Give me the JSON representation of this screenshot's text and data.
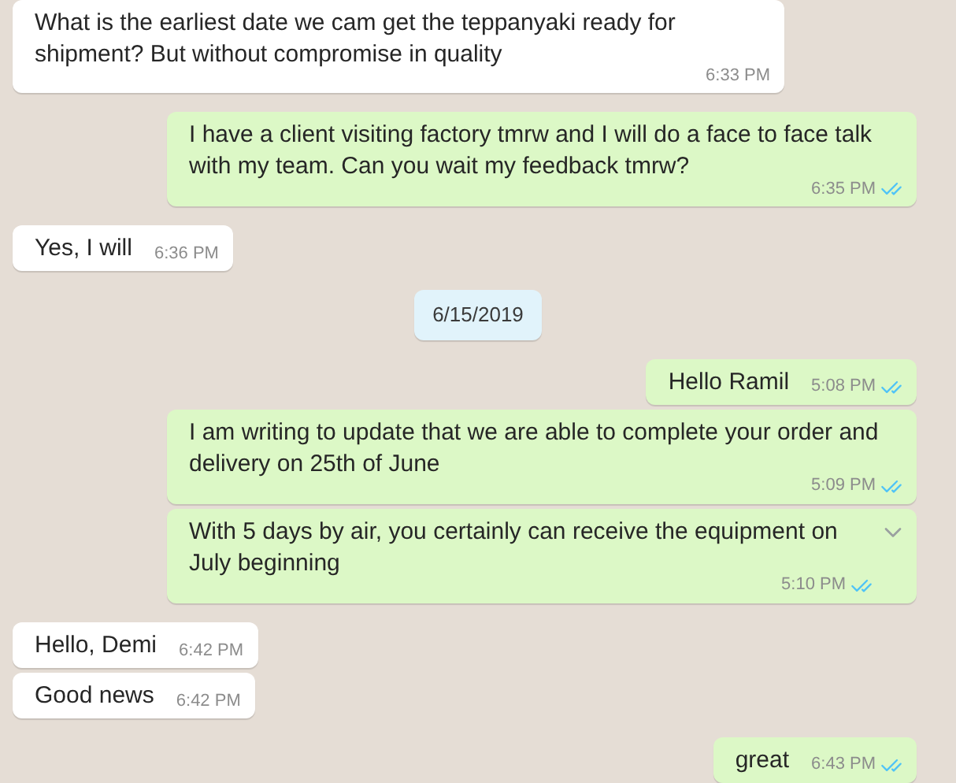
{
  "messages": [
    {
      "kind": "incoming",
      "text": "What is the earliest date we cam get the teppanyaki ready for shipment? But without compromise in quality",
      "time": "6:33 PM",
      "hovered": false
    },
    {
      "kind": "outgoing",
      "text": "I have a client visiting factory tmrw and I will do a face to face talk with my team. Can you wait my feedback tmrw?",
      "time": "6:35 PM",
      "read": true,
      "hovered": false
    },
    {
      "kind": "incoming",
      "text": "Yes, I will",
      "time": "6:36 PM",
      "hovered": false
    },
    {
      "kind": "date",
      "text": "6/15/2019"
    },
    {
      "kind": "outgoing",
      "text": "Hello Ramil",
      "time": "5:08 PM",
      "read": true,
      "hovered": false
    },
    {
      "kind": "outgoing",
      "text": "I am writing to update that we are able to complete your order and delivery on 25th of June",
      "time": "5:09 PM",
      "read": true,
      "hovered": false
    },
    {
      "kind": "outgoing",
      "text": "With 5 days by air, you certainly can receive the equipment on July beginning",
      "time": "5:10 PM",
      "read": true,
      "hovered": true
    },
    {
      "kind": "incoming",
      "text": "Hello, Demi",
      "time": "6:42 PM",
      "hovered": false
    },
    {
      "kind": "incoming",
      "text": "Good news",
      "time": "6:42 PM",
      "hovered": false
    },
    {
      "kind": "outgoing",
      "text": "great",
      "time": "6:43 PM",
      "read": true,
      "hovered": false
    }
  ]
}
